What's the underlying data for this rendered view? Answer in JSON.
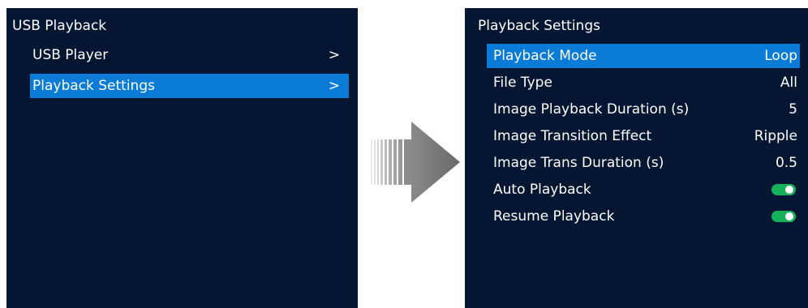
{
  "left_screen": {
    "title": "USB Playback",
    "items": [
      {
        "label": "USB Player",
        "chevron": ">"
      },
      {
        "label": "Playback Settings",
        "chevron": ">"
      }
    ]
  },
  "right_screen": {
    "title": "Playback Settings",
    "items": [
      {
        "label": "Playback Mode",
        "value": "Loop"
      },
      {
        "label": "File Type",
        "value": "All"
      },
      {
        "label": "Image Playback Duration (s)",
        "value": "5"
      },
      {
        "label": "Image Transition Effect",
        "value": "Ripple"
      },
      {
        "label": "Image Trans Duration (s)",
        "value": "0.5"
      },
      {
        "label": "Auto Playback",
        "toggle": true
      },
      {
        "label": "Resume Playback",
        "toggle": true
      }
    ]
  },
  "colors": {
    "screen_bg": "#051633",
    "selection": "#0a7bd6",
    "toggle_on": "#14b15a"
  },
  "icons": {
    "transition_arrow": "right-arrow-icon",
    "toggle": "toggle-switch-icon"
  }
}
